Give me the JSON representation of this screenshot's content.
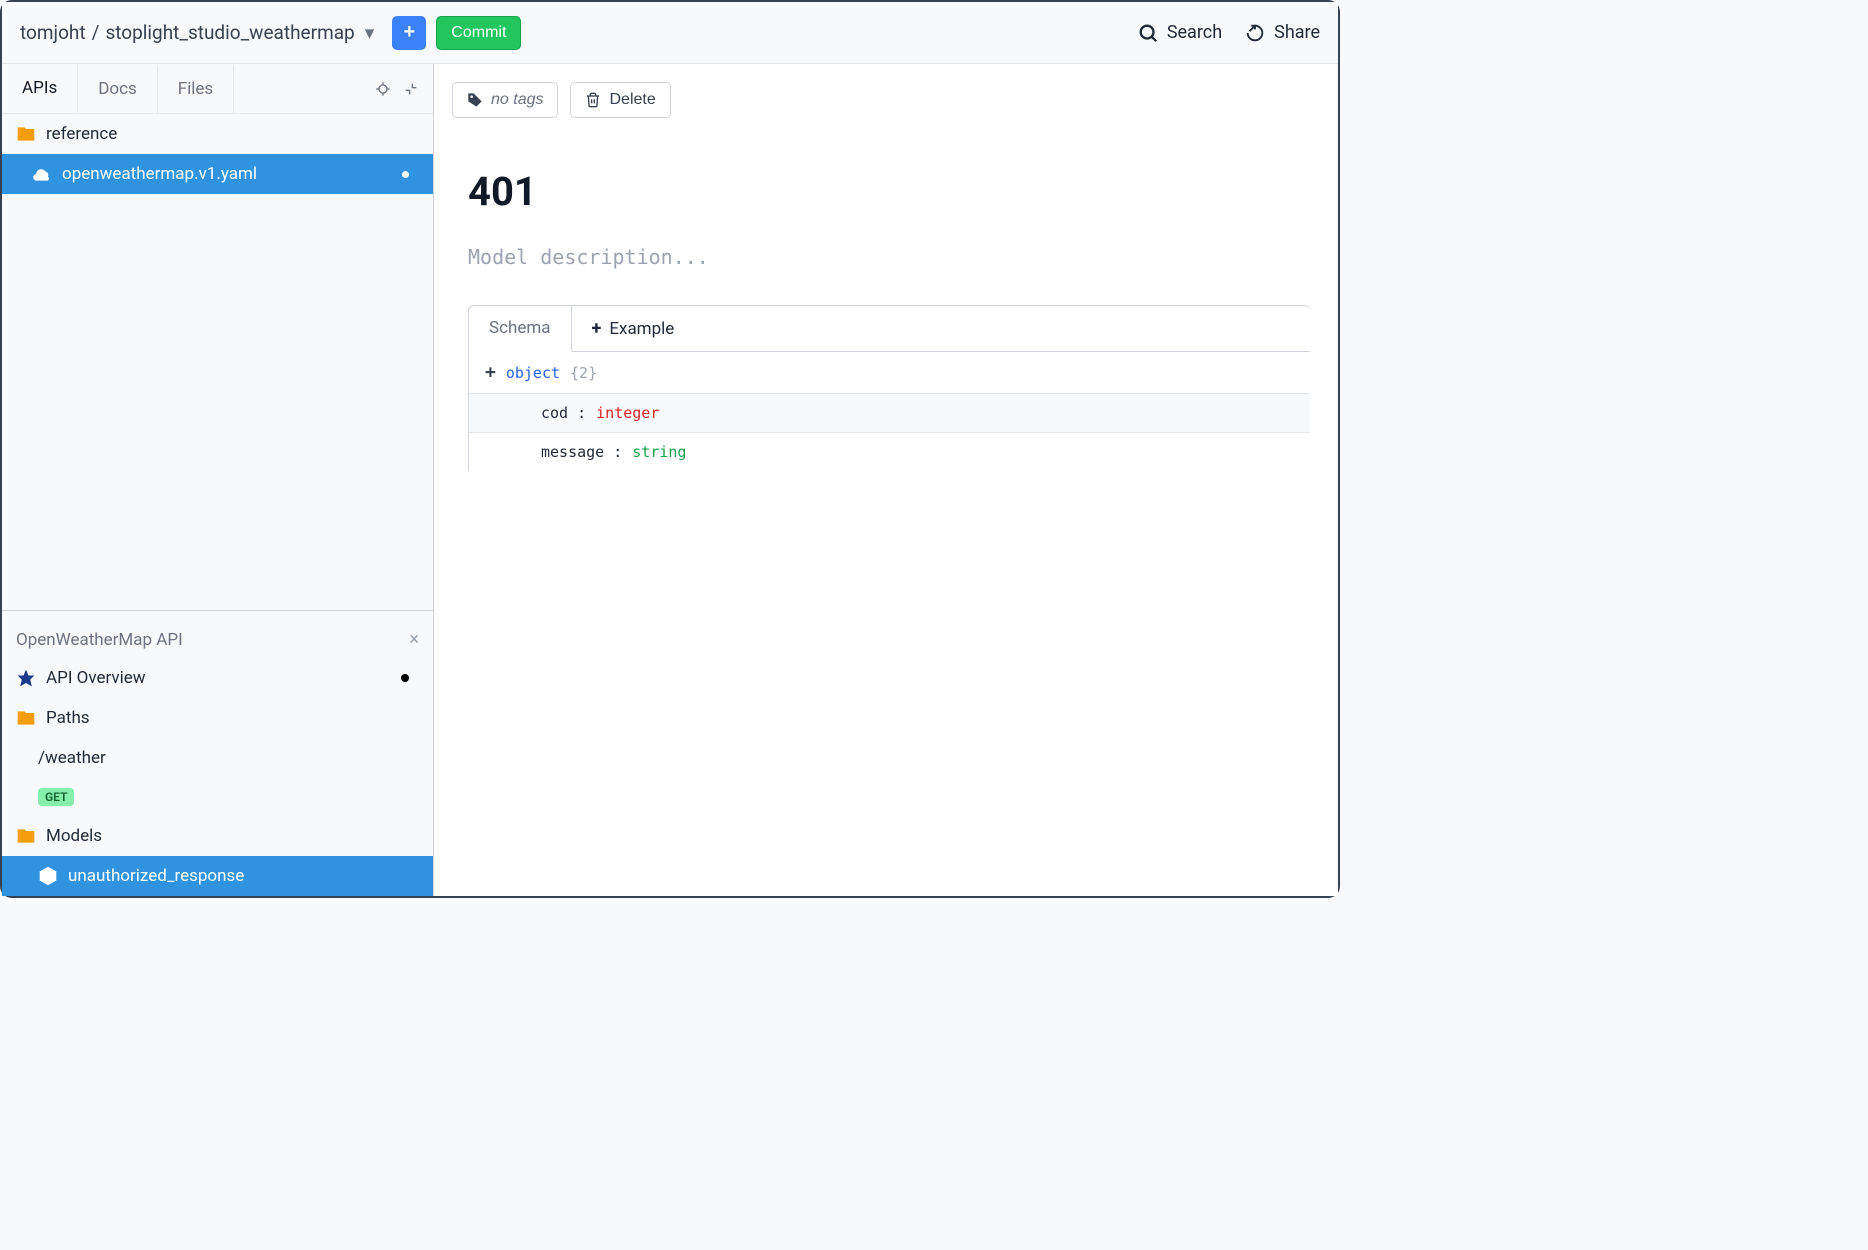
{
  "header": {
    "breadcrumb_owner": "tomjoht",
    "breadcrumb_sep": "/",
    "breadcrumb_repo": "stoplight_studio_weathermap",
    "add_label": "+",
    "commit_label": "Commit",
    "search_label": "Search",
    "share_label": "Share"
  },
  "sidebar": {
    "tabs": {
      "apis": "APIs",
      "docs": "Docs",
      "files": "Files"
    },
    "tree": {
      "root_folder": "reference",
      "file": "openweathermap.v1.yaml"
    },
    "api": {
      "title": "OpenWeatherMap API",
      "overview": "API Overview",
      "paths_label": "Paths",
      "path_weather": "/weather",
      "method_get": "GET",
      "models_label": "Models",
      "model_unauthorized": "unauthorized_response"
    }
  },
  "main": {
    "tags_label": "no tags",
    "delete_label": "Delete",
    "model_title": "401",
    "model_desc_placeholder": "Model description...",
    "schema_tab": "Schema",
    "example_tab": "Example",
    "root_type": "object",
    "root_count": "{2}",
    "props": [
      {
        "name": "cod :",
        "type": "integer"
      },
      {
        "name": "message :",
        "type": "string"
      }
    ]
  }
}
